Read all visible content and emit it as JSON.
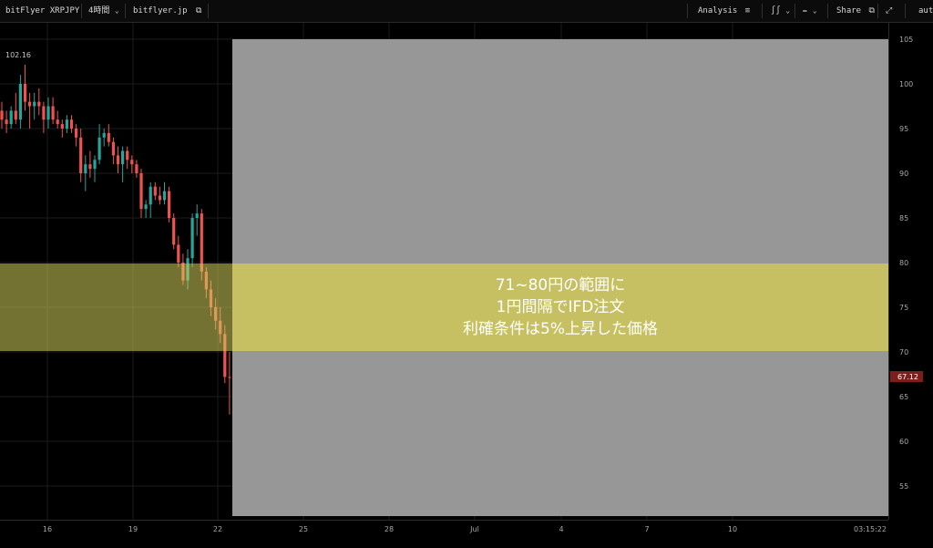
{
  "toolbar": {
    "symbol": "bitFlyer XRPJPY",
    "interval": "4時間",
    "site": "bitflyer.jp",
    "analysis": "Analysis",
    "share": "Share",
    "user_partial": "aut",
    "icons": [
      "chevron-down-icon",
      "external-link-icon",
      "indicator-icon",
      "candle-icon",
      "pencil-icon",
      "share-external-icon",
      "expand-icon"
    ]
  },
  "overlay": {
    "lines": [
      "71~80円の範囲に",
      "1円間隔でIFD注文",
      "利確条件は5%上昇した価格"
    ],
    "band_color": "#d4cf5c",
    "grey_color": "#979797"
  },
  "chart_data": {
    "type": "candlestick",
    "y_ticks": [
      55,
      60,
      65,
      70,
      75,
      80,
      85,
      90,
      95,
      100,
      105
    ],
    "ylim": [
      51,
      106
    ],
    "x_ticks": [
      "16",
      "19",
      "22",
      "25",
      "28",
      "Jul",
      "4",
      "7",
      "10",
      "03:15:22"
    ],
    "high_label": "102.16",
    "last_price": "67.12",
    "up_color": "#26a69a",
    "down_color": "#ef5350",
    "candles": [
      {
        "o": 97,
        "h": 98,
        "l": 95,
        "c": 96
      },
      {
        "o": 96,
        "h": 97,
        "l": 94.5,
        "c": 95.5
      },
      {
        "o": 95.5,
        "h": 97.5,
        "l": 95,
        "c": 97
      },
      {
        "o": 97,
        "h": 99,
        "l": 95.5,
        "c": 96
      },
      {
        "o": 96,
        "h": 101,
        "l": 95,
        "c": 100
      },
      {
        "o": 100,
        "h": 102.16,
        "l": 97,
        "c": 98
      },
      {
        "o": 98,
        "h": 99,
        "l": 95,
        "c": 97.5
      },
      {
        "o": 97.5,
        "h": 99,
        "l": 96,
        "c": 98
      },
      {
        "o": 98,
        "h": 99.5,
        "l": 96.5,
        "c": 97.5
      },
      {
        "o": 97.5,
        "h": 98,
        "l": 94.5,
        "c": 96
      },
      {
        "o": 96,
        "h": 98.5,
        "l": 95,
        "c": 97.5
      },
      {
        "o": 97.5,
        "h": 98.5,
        "l": 95.5,
        "c": 96
      },
      {
        "o": 96,
        "h": 97,
        "l": 95,
        "c": 95.5
      },
      {
        "o": 95.5,
        "h": 96,
        "l": 94,
        "c": 95
      },
      {
        "o": 95,
        "h": 96.5,
        "l": 94.5,
        "c": 96
      },
      {
        "o": 96,
        "h": 96.5,
        "l": 94.5,
        "c": 95
      },
      {
        "o": 95,
        "h": 95.5,
        "l": 93,
        "c": 94
      },
      {
        "o": 94,
        "h": 95,
        "l": 89,
        "c": 90
      },
      {
        "o": 90,
        "h": 92,
        "l": 88,
        "c": 91
      },
      {
        "o": 91,
        "h": 92.5,
        "l": 89.5,
        "c": 90.5
      },
      {
        "o": 90.5,
        "h": 92,
        "l": 89,
        "c": 91.5
      },
      {
        "o": 91.5,
        "h": 95.5,
        "l": 91,
        "c": 94
      },
      {
        "o": 94,
        "h": 95,
        "l": 93,
        "c": 94.5
      },
      {
        "o": 94.5,
        "h": 95.5,
        "l": 93,
        "c": 93.5
      },
      {
        "o": 93.5,
        "h": 94,
        "l": 91,
        "c": 92
      },
      {
        "o": 92,
        "h": 93,
        "l": 90,
        "c": 91
      },
      {
        "o": 91,
        "h": 93,
        "l": 89,
        "c": 92.5
      },
      {
        "o": 92.5,
        "h": 93,
        "l": 90.5,
        "c": 91.5
      },
      {
        "o": 91.5,
        "h": 92,
        "l": 90,
        "c": 91
      },
      {
        "o": 91,
        "h": 91.5,
        "l": 89.5,
        "c": 90
      },
      {
        "o": 90,
        "h": 90.5,
        "l": 85,
        "c": 86
      },
      {
        "o": 86,
        "h": 87,
        "l": 85,
        "c": 86.5
      },
      {
        "o": 86.5,
        "h": 89,
        "l": 85,
        "c": 88.5
      },
      {
        "o": 88.5,
        "h": 89,
        "l": 87,
        "c": 87.5
      },
      {
        "o": 87.5,
        "h": 88.5,
        "l": 86.5,
        "c": 87
      },
      {
        "o": 87,
        "h": 89,
        "l": 86.5,
        "c": 88
      },
      {
        "o": 88,
        "h": 88.5,
        "l": 84.5,
        "c": 85
      },
      {
        "o": 85,
        "h": 85.5,
        "l": 81.5,
        "c": 82
      },
      {
        "o": 82,
        "h": 83,
        "l": 79.5,
        "c": 80
      },
      {
        "o": 80,
        "h": 81,
        "l": 77.5,
        "c": 78
      },
      {
        "o": 78,
        "h": 81.5,
        "l": 77,
        "c": 80.5
      },
      {
        "o": 80.5,
        "h": 85.5,
        "l": 79.5,
        "c": 85
      },
      {
        "o": 85,
        "h": 86.5,
        "l": 83,
        "c": 85.5
      },
      {
        "o": 85.5,
        "h": 86,
        "l": 78,
        "c": 79
      },
      {
        "o": 79,
        "h": 79.5,
        "l": 76,
        "c": 77
      },
      {
        "o": 77,
        "h": 78,
        "l": 74,
        "c": 75
      },
      {
        "o": 75,
        "h": 76,
        "l": 72.5,
        "c": 73.5
      },
      {
        "o": 73.5,
        "h": 75,
        "l": 71,
        "c": 72
      },
      {
        "o": 72,
        "h": 73,
        "l": 66.5,
        "c": 67.2
      },
      {
        "o": 67.2,
        "h": 70,
        "l": 63,
        "c": 67.12
      }
    ]
  }
}
